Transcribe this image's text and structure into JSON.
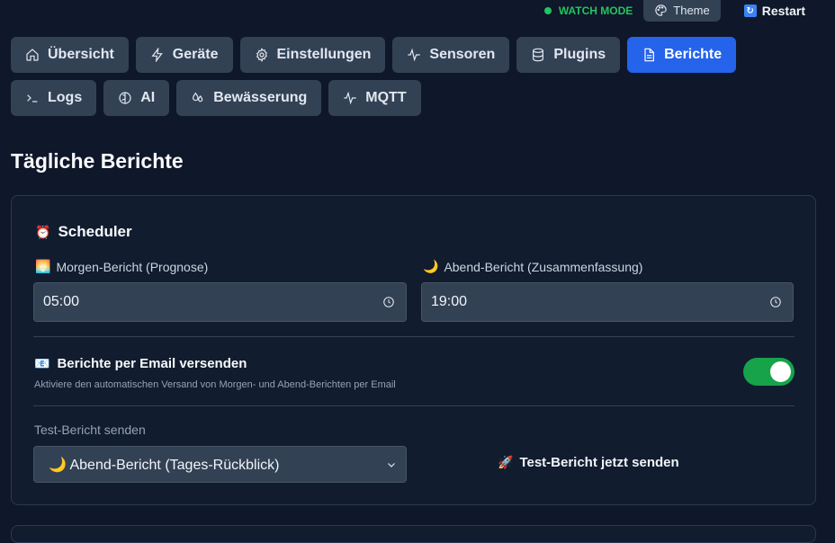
{
  "header": {
    "watch_mode": "WATCH MODE",
    "theme_label": "Theme",
    "restart_label": "Restart"
  },
  "tabs": [
    {
      "label": "Übersicht",
      "icon": "home-icon"
    },
    {
      "label": "Geräte",
      "icon": "bolt-icon"
    },
    {
      "label": "Einstellungen",
      "icon": "gear-icon"
    },
    {
      "label": "Sensoren",
      "icon": "activity-icon"
    },
    {
      "label": "Plugins",
      "icon": "database-icon"
    },
    {
      "label": "Berichte",
      "icon": "document-icon",
      "active": true
    },
    {
      "label": "Logs",
      "icon": "terminal-icon"
    },
    {
      "label": "AI",
      "icon": "brain-icon"
    },
    {
      "label": "Bewässerung",
      "icon": "droplets-icon"
    },
    {
      "label": "MQTT",
      "icon": "activity-icon"
    }
  ],
  "page": {
    "title": "Tägliche Berichte"
  },
  "scheduler": {
    "title": "Scheduler",
    "title_icon": "⏰",
    "morning_label": "Morgen-Bericht (Prognose)",
    "morning_icon": "🌅",
    "morning_time": "05:00",
    "evening_label": "Abend-Bericht (Zusammenfassung)",
    "evening_icon": "🌙",
    "evening_time": "19:00",
    "email_icon": "📧",
    "email_title": "Berichte per Email versenden",
    "email_desc": "Aktiviere den automatischen Versand von Morgen- und Abend-Berichten per Email",
    "email_enabled": true,
    "test_label": "Test-Bericht senden",
    "test_selected": "🌙 Abend-Bericht (Tages-Rückblick)",
    "send_icon": "🚀",
    "send_label": "Test-Bericht jetzt senden"
  },
  "colors": {
    "background": "#0f172a",
    "tab": "#334155",
    "tab_active": "#2563eb",
    "toggle_on": "#16a34a",
    "watch_green": "#22c55e"
  }
}
